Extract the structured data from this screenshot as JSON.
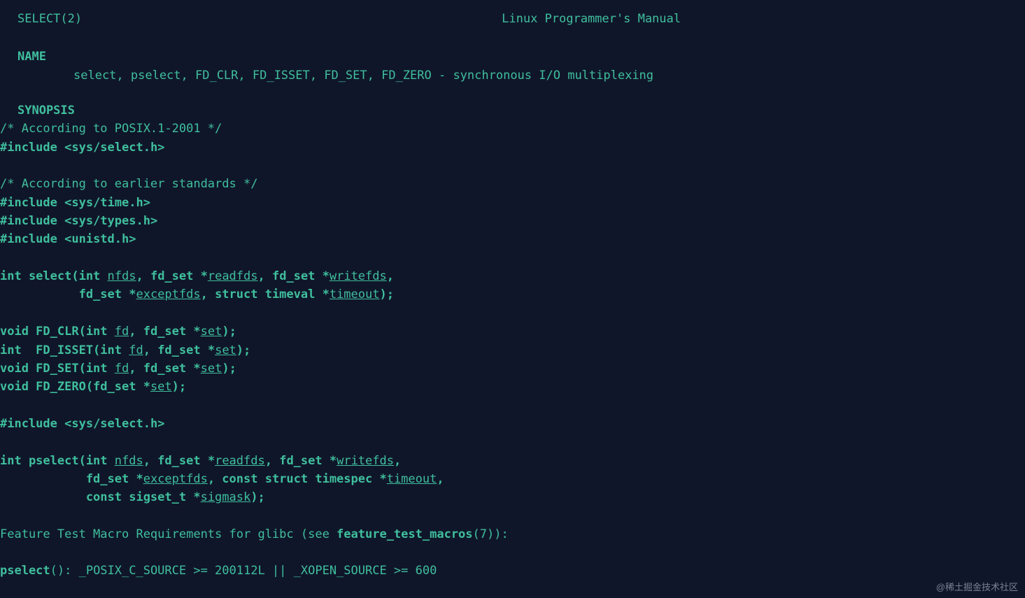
{
  "header": {
    "left": "SELECT(2)",
    "center": "Linux Programmer's Manual"
  },
  "sections": {
    "name_head": "NAME",
    "name_body": "select, pselect, FD_CLR, FD_ISSET, FD_SET, FD_ZERO - synchronous I/O multiplexing",
    "synopsis_head": "SYNOPSIS",
    "syn": {
      "c1": "/* According to POSIX.1-2001 */",
      "i1_a": "#include ",
      "i1_b": "<sys/select.h>",
      "c2": "/* According to earlier standards */",
      "i2_a": "#include ",
      "i2_b": "<sys/time.h>",
      "i3_a": "#include ",
      "i3_b": "<sys/types.h>",
      "i4_a": "#include ",
      "i4_b": "<unistd.h>",
      "sel_1a": "int select(int ",
      "sel_1b": "nfds",
      "sel_1c": ", fd_set *",
      "sel_1d": "readfds",
      "sel_1e": ", fd_set *",
      "sel_1f": "writefds",
      "sel_1g": ",",
      "sel_2a": "           fd_set *",
      "sel_2b": "exceptfds",
      "sel_2c": ", struct timeval *",
      "sel_2d": "timeout",
      "sel_2e": ");",
      "clr_a": "void FD_CLR(int ",
      "clr_b": "fd",
      "clr_c": ", fd_set *",
      "clr_d": "set",
      "clr_e": ");",
      "iss_a": "int  FD_ISSET(int ",
      "iss_b": "fd",
      "iss_c": ", fd_set *",
      "iss_d": "set",
      "iss_e": ");",
      "set_a": "void FD_SET(int ",
      "set_b": "fd",
      "set_c": ", fd_set *",
      "set_d": "set",
      "set_e": ");",
      "zer_a": "void FD_ZERO(fd_set *",
      "zer_b": "set",
      "zer_c": ");",
      "i5_a": "#include ",
      "i5_b": "<sys/select.h>",
      "psel_1a": "int pselect(int ",
      "psel_1b": "nfds",
      "psel_1c": ", fd_set *",
      "psel_1d": "readfds",
      "psel_1e": ", fd_set *",
      "psel_1f": "writefds",
      "psel_1g": ",",
      "psel_2a": "            fd_set *",
      "psel_2b": "exceptfds",
      "psel_2c": ", const struct timespec *",
      "psel_2d": "timeout",
      "psel_2e": ",",
      "psel_3a": "            const sigset_t *",
      "psel_3b": "sigmask",
      "psel_3c": ");",
      "ftm_a": "Feature Test Macro Requirements for glibc (see ",
      "ftm_b": "feature_test_macros",
      "ftm_c": "(7)):",
      "psel_req_a": "pselect",
      "psel_req_b": "(): _POSIX_C_SOURCE >= 200112L || _XOPEN_SOURCE >= 600"
    }
  },
  "watermark": "@稀土掘金技术社区"
}
